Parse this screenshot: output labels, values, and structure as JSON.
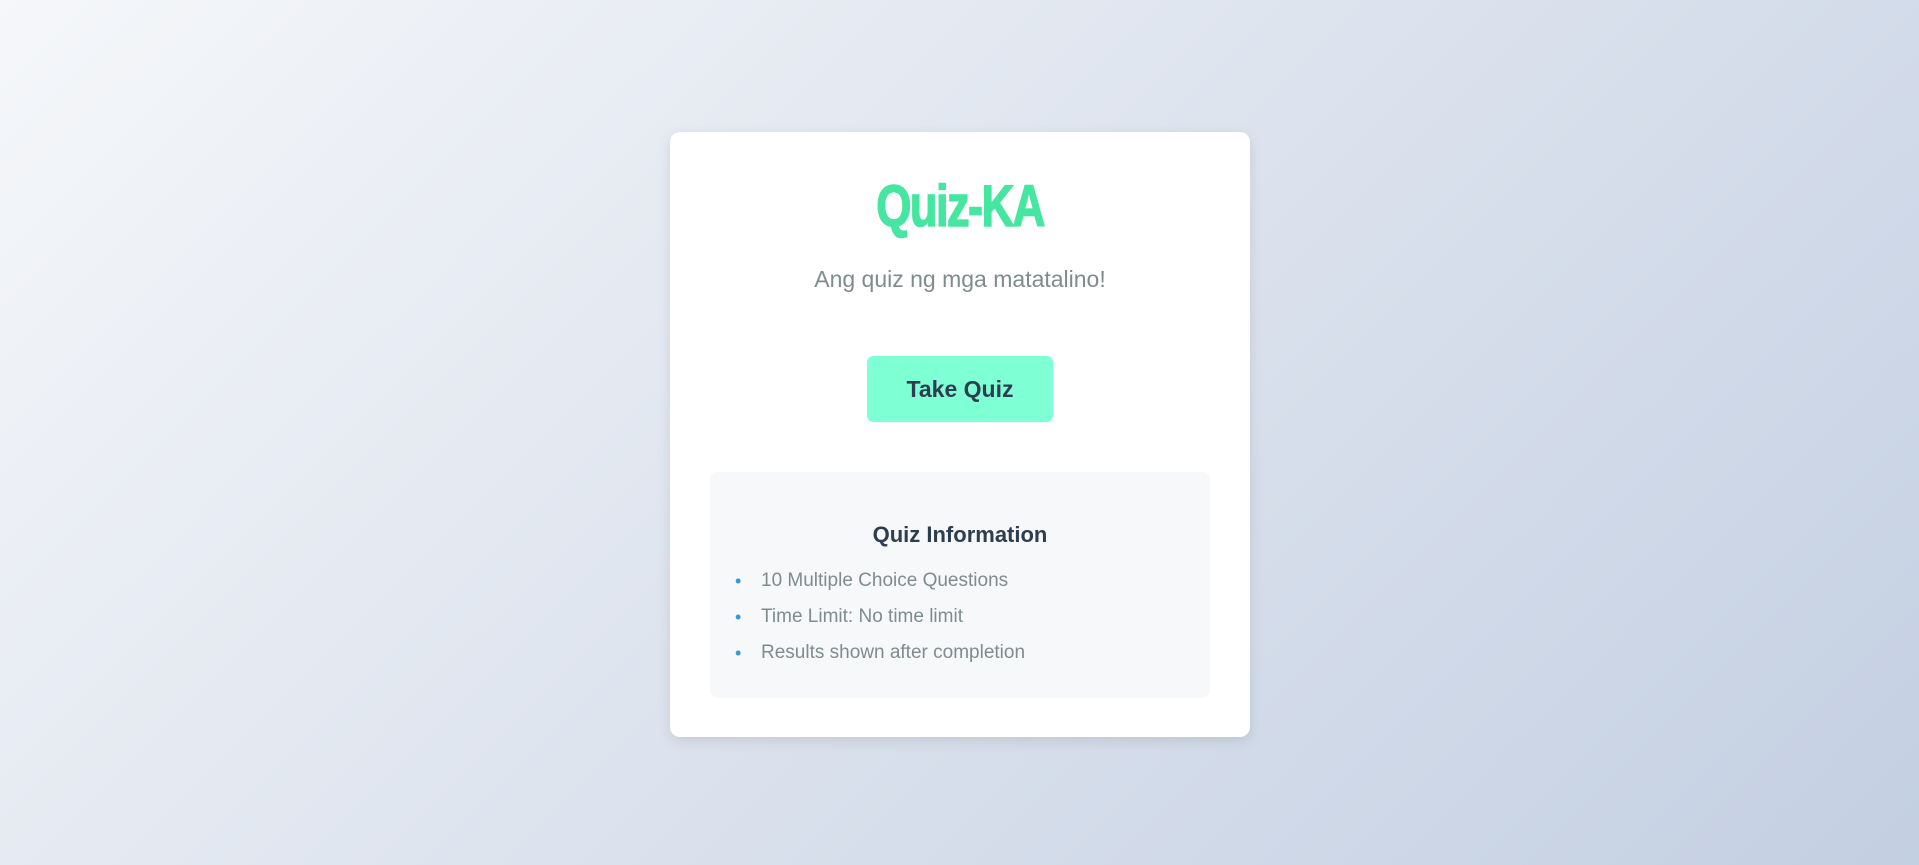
{
  "app": {
    "title": "Quiz-KA",
    "subtitle": "Ang quiz ng mga matatalino!"
  },
  "actions": {
    "take_quiz_label": "Take Quiz"
  },
  "info": {
    "heading": "Quiz Information",
    "items": [
      "10 Multiple Choice Questions",
      "Time Limit: No time limit",
      "Results shown after completion"
    ],
    "bullet_icon": "bullet-dot-icon"
  },
  "colors": {
    "title": "#45e6a0",
    "button_bg": "#7fffd4",
    "button_text": "#2c3e50",
    "bullet": "#3498db",
    "muted_text": "#7f8c8d"
  }
}
